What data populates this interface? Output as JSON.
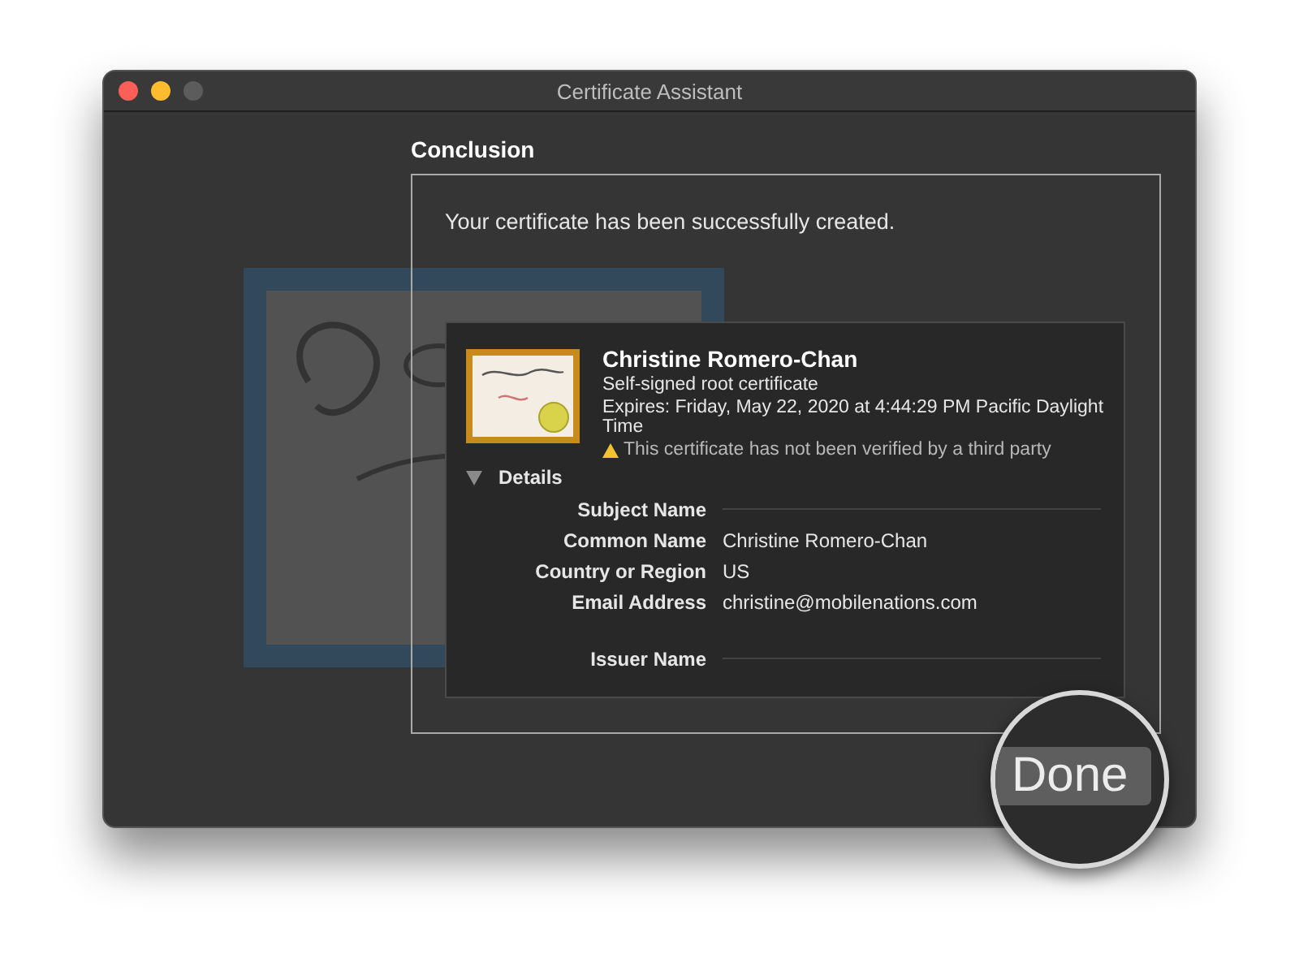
{
  "window": {
    "title": "Certificate Assistant"
  },
  "heading": "Conclusion",
  "message": "Your certificate has been successfully created.",
  "certificate": {
    "name": "Christine Romero-Chan",
    "type": "Self-signed root certificate",
    "expires": "Expires: Friday, May 22, 2020 at 4:44:29 PM Pacific Daylight Time",
    "warning": "This certificate has not been verified by a third party"
  },
  "details": {
    "label": "Details",
    "expanded": true,
    "rows": [
      {
        "kind": "section",
        "label": "Subject Name"
      },
      {
        "kind": "field",
        "label": "Common Name",
        "value": "Christine Romero-Chan"
      },
      {
        "kind": "field",
        "label": "Country or Region",
        "value": "US"
      },
      {
        "kind": "field",
        "label": "Email Address",
        "value": "christine@mobilenations.com"
      },
      {
        "kind": "gap"
      },
      {
        "kind": "section",
        "label": "Issuer Name"
      }
    ]
  },
  "done_button": {
    "label": "Done"
  }
}
